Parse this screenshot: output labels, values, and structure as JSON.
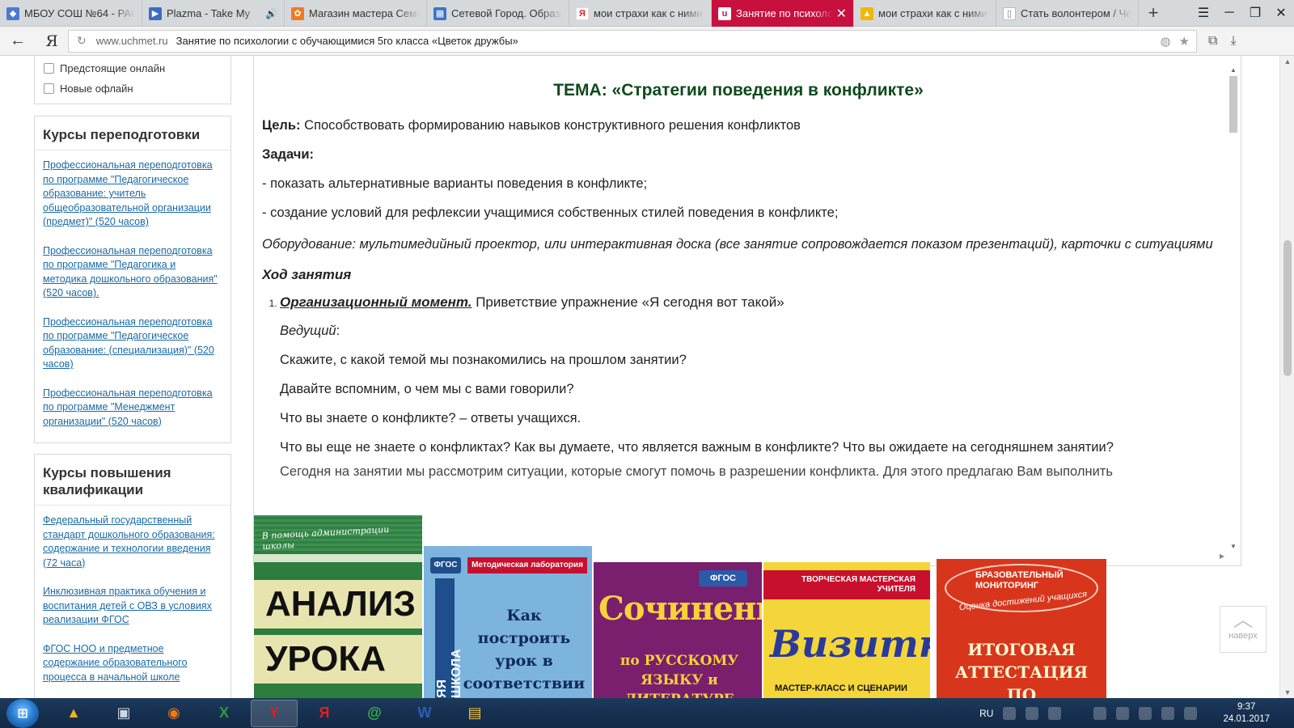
{
  "tabs": [
    {
      "label": "МБОУ СОШ №64 - РАС",
      "favicon": "diamond-icon",
      "color": "#4a7bd0",
      "active": false
    },
    {
      "label": "Plazma - Take My",
      "favicon": "video-icon",
      "color": "#3a6ec2",
      "active": false,
      "audio": true
    },
    {
      "label": "Магазин мастера Семё",
      "favicon": "shop-icon",
      "color": "#ef7b22",
      "active": false
    },
    {
      "label": "Сетевой Город. Образо",
      "favicon": "grid-icon",
      "color": "#3a74c8",
      "active": false
    },
    {
      "label": "мои страхи как с ними",
      "favicon": "yandex-icon",
      "color": "#e02020",
      "active": false
    },
    {
      "label": "Занятие по психолог",
      "favicon": "uchmet-icon",
      "color": "#ffffff",
      "active": true
    },
    {
      "label": "мои страхи как с ними",
      "favicon": "image-icon",
      "color": "#f2b705",
      "active": false
    },
    {
      "label": "Стать волонтером / Чем",
      "favicon": "document-icon",
      "color": "#777777",
      "active": false
    }
  ],
  "address": {
    "domain": "www.uchmet.ru",
    "title": "Занятие по психологии с обучающимися 5го класса «Цветок дружбы»"
  },
  "filters": {
    "items": [
      "Предстоящие онлайн",
      "Новые офлайн"
    ]
  },
  "courses": {
    "title": "Курсы переподготовки",
    "links": [
      "Профессиональная переподготовка по программе \"Педагогическое образование: учитель общеобразовательной организации (предмет)\" (520 часов)",
      "Профессиональная переподготовка по программе \"Педагогика и методика дошкольного образования\" (520 часов).",
      "Профессиональная переподготовка по программе \"Педагогическое образование: (специализация)\" (520 часов)",
      "Профессиональная переподготовка по программе \"Менеджмент организации\" (520 часов)"
    ]
  },
  "qual": {
    "title": "Курсы повышения квалификации",
    "links": [
      "Федеральный государственный стандарт дошкольного образования: содержание и технологии введения (72 часа)",
      "Инклюзивная практика обучения и воспитания детей с ОВЗ в условиях реализации ФГОС",
      "ФГОС НОО и предметное содержание образовательного процесса в начальной школе"
    ]
  },
  "doc": {
    "heading": "ТЕМА: «Стратегии поведения в конфликте»",
    "goal_label": "Цель:",
    "goal_text": " Способствовать формированию навыков конструктивного решения конфликтов",
    "tasks_label": "Задачи:",
    "task1": "- показать альтернативные варианты поведения в конфликте;",
    "task2": "- создание условий для рефлексии учащимися собственных стилей поведения в конфликте;",
    "equipment": "Оборудование: мультимедийный проектор, или интерактивная доска (все занятие сопровождается показом презентаций), карточки с ситуациями",
    "hod": "Ход занятия",
    "org_title": "Организационный момент.",
    "org_text": " Приветствие упражнение «Я сегодня вот такой»",
    "leader": "Ведущий",
    "leader_colon": ":",
    "q1": "Скажите, с какой темой мы познакомились на прошлом занятии?",
    "q2": "Давайте вспомним, о чем мы с вами говорили?",
    "q3": "Что вы знаете о конфликте? – ответы учащихся.",
    "q4": "Что вы еще не знаете о конфликтах? Как вы думаете, что является важным в конфликте? Что вы ожидаете на сегодняшнем занятии?",
    "q5": "Сегодня на занятии мы рассмотрим ситуации, которые смогут помочь в разрешении конфликта. Для этого предлагаю Вам выполнить"
  },
  "books": {
    "b1_sub": "В помощь администрации школы",
    "b1_w1": "АНАЛИЗ",
    "b1_w2": "УРОКА",
    "b2_fgos": "ФГОС",
    "b2_lab": "Методическая лаборатория",
    "b2_spine": "ЯЯ ШКОЛА",
    "b2_title": "Как построить урок в соответствии с ФГОС",
    "b3_fgos": "ФГОС",
    "b3_title": "Сочинения",
    "b3_sub": "по РУССКОМУ ЯЗЫКУ и ЛИТЕРАТУРЕ",
    "b4_top": "ТВОРЧЕСКАЯ МАСТЕРСКАЯ УЧИТЕЛЯ",
    "b4_title": "Визитки",
    "b4_sub": "МАСТЕР-КЛАСС И СЦЕНАРИИ",
    "b5_top": "БРАЗОВАТЕЛЬНЫЙ МОНИТОРИНГ",
    "b5_arc": "Оценка достижений учащихся",
    "b5_title": "ИТОГОВАЯ АТТЕСТАЦИЯ ПО ОКОНЧАНИИ"
  },
  "totop": {
    "caret": "︿",
    "label": "наверх"
  },
  "taskbar": {
    "lang": "RU",
    "time": "9:37",
    "date": "24.01.2017",
    "items": [
      {
        "name": "aimp-icon",
        "glyph": "▲",
        "color": "#f0b020"
      },
      {
        "name": "media-player-icon",
        "glyph": "▣",
        "color": "#cfd8e6"
      },
      {
        "name": "firefox-icon",
        "glyph": "◉",
        "color": "#f07a1a"
      },
      {
        "name": "excel-icon",
        "glyph": "X",
        "color": "#2f9a3c"
      },
      {
        "name": "yandex-browser-icon",
        "glyph": "Y",
        "color": "#e02020",
        "active": true
      },
      {
        "name": "yandex-icon",
        "glyph": "Я",
        "color": "#e02020"
      },
      {
        "name": "mail-agent-icon",
        "glyph": "@",
        "color": "#3ab54a"
      },
      {
        "name": "word-icon",
        "glyph": "W",
        "color": "#2b5fb4"
      },
      {
        "name": "explorer-icon",
        "glyph": "▤",
        "color": "#f3c544"
      }
    ]
  }
}
